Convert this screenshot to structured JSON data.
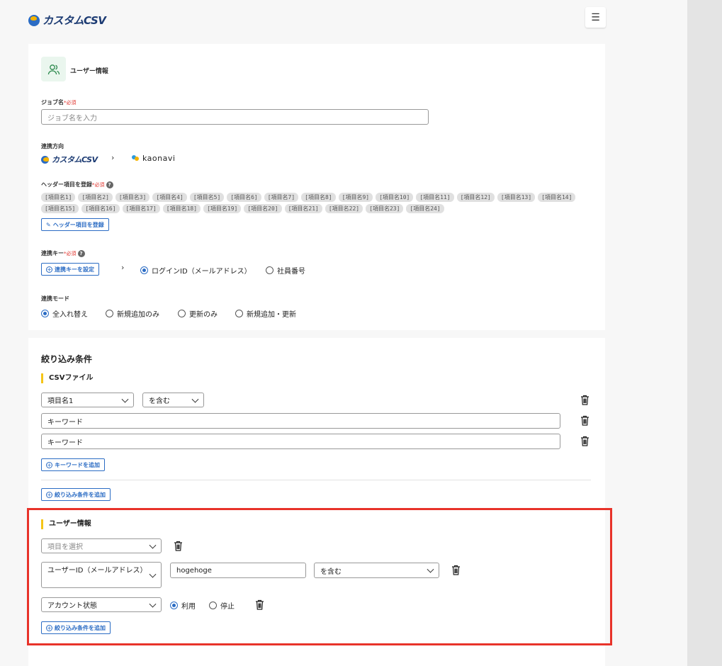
{
  "app": {
    "logo_text": "カスタムCSV",
    "menu_icon": "hamburger-icon"
  },
  "user_section": {
    "title": "ユーザー情報",
    "job_name": {
      "label": "ジョブ名",
      "required": "*必須",
      "placeholder": "ジョブ名を入力"
    },
    "direction": {
      "label": "連携方向",
      "from": "カスタムCSV",
      "to": "kaonavi"
    },
    "header": {
      "label": "ヘッダー項目を登録",
      "required": "*必須",
      "items": [
        "[項目名1]",
        "[項目名2]",
        "[項目名3]",
        "[項目名4]",
        "[項目名5]",
        "[項目名6]",
        "[項目名7]",
        "[項目名8]",
        "[項目名9]",
        "[項目名10]",
        "[項目名11]",
        "[項目名12]",
        "[項目名13]",
        "[項目名14]",
        "[項目名15]",
        "[項目名16]",
        "[項目名17]",
        "[項目名18]",
        "[項目名19]",
        "[項目名20]",
        "[項目名21]",
        "[項目名22]",
        "[項目名23]",
        "[項目名24]"
      ],
      "button": "ヘッダー項目を登録"
    },
    "key": {
      "label": "連携キー",
      "required": "*必須",
      "button": "連携キーを設定",
      "options": [
        "ログインID（メールアドレス）",
        "社員番号"
      ],
      "selected": 0
    },
    "mode": {
      "label": "連携モード",
      "options": [
        "全入れ替え",
        "新規追加のみ",
        "更新のみ",
        "新規追加・更新"
      ],
      "selected": 0
    }
  },
  "filter_section": {
    "title": "絞り込み条件",
    "csv": {
      "title": "CSVファイル",
      "field_select": "項目名1",
      "op_select": "を含む",
      "keywords": [
        "キーワード",
        "キーワード"
      ],
      "add_keyword": "キーワードを追加",
      "add_condition": "絞り込み条件を追加"
    },
    "user": {
      "title": "ユーザー情報",
      "item_placeholder": "項目を選択",
      "row2_field": "ユーザーID（メールアドレス）",
      "row2_value": "hogehoge",
      "row2_op": "を含む",
      "row3_field": "アカウント状態",
      "row3_options": [
        "利用",
        "停止"
      ],
      "row3_selected": 0,
      "add_condition": "絞り込み条件を追加"
    }
  },
  "colors": {
    "accent": "#2b6cc4",
    "highlight": "#e8332a",
    "required": "#e0302a",
    "section_bar": "#f5c518"
  }
}
